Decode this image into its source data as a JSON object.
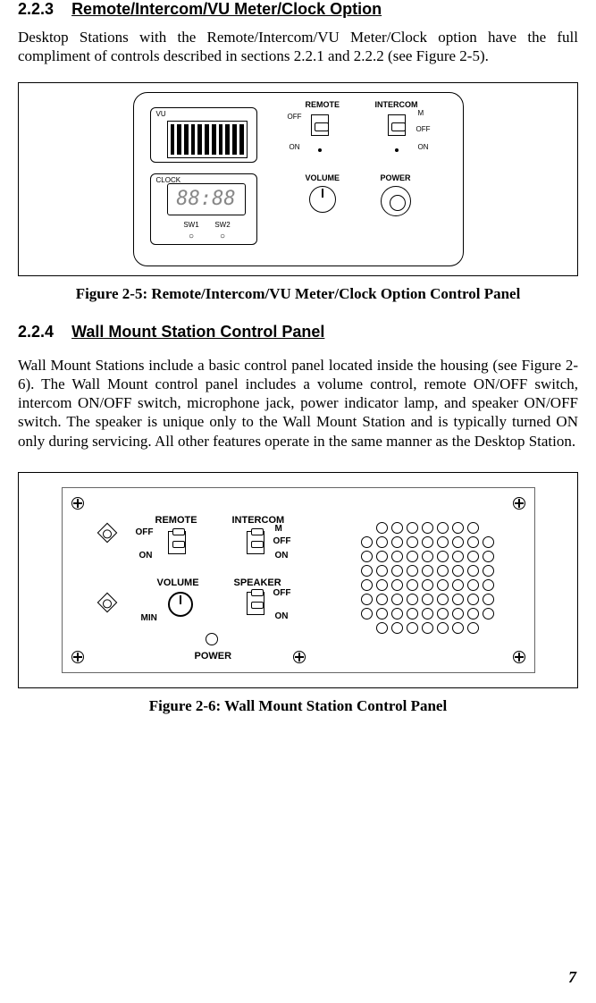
{
  "section223": {
    "number": "2.2.3",
    "title": "Remote/Intercom/VU Meter/Clock Option",
    "paragraph": "Desktop Stations with the Remote/Intercom/VU Meter/Clock option have the full compliment of controls described in sections 2.2.1 and 2.2.2 (see Figure 2-5)."
  },
  "figure25": {
    "caption": "Figure 2-5:  Remote/Intercom/VU Meter/Clock Option Control Panel",
    "vu_label": "VU",
    "clock_label": "CLOCK",
    "clock_display": "88:88",
    "sw1": "SW1",
    "sw2": "SW2",
    "remote": "REMOTE",
    "intercom": "INTERCOM",
    "volume": "VOLUME",
    "power": "POWER",
    "off": "OFF",
    "on": "ON",
    "m": "M"
  },
  "section224": {
    "number": "2.2.4",
    "title": "Wall Mount Station Control Panel",
    "paragraph": "Wall Mount Stations include a basic control panel located inside the housing (see Figure 2-6).  The Wall Mount control panel includes a volume control, remote ON/OFF switch, intercom ON/OFF switch, microphone jack, power indicator lamp, and speaker ON/OFF switch.  The speaker is unique only to the Wall Mount Station and is typically turned ON only during servicing.  All other features operate in the same manner as the Desktop Station."
  },
  "figure26": {
    "caption": "Figure 2-6:  Wall Mount Station Control Panel",
    "remote": "REMOTE",
    "intercom": "INTERCOM",
    "volume": "VOLUME",
    "speaker": "SPEAKER",
    "power": "POWER",
    "off": "OFF",
    "on": "ON",
    "m": "M",
    "min": "MIN"
  },
  "page_number": "7"
}
